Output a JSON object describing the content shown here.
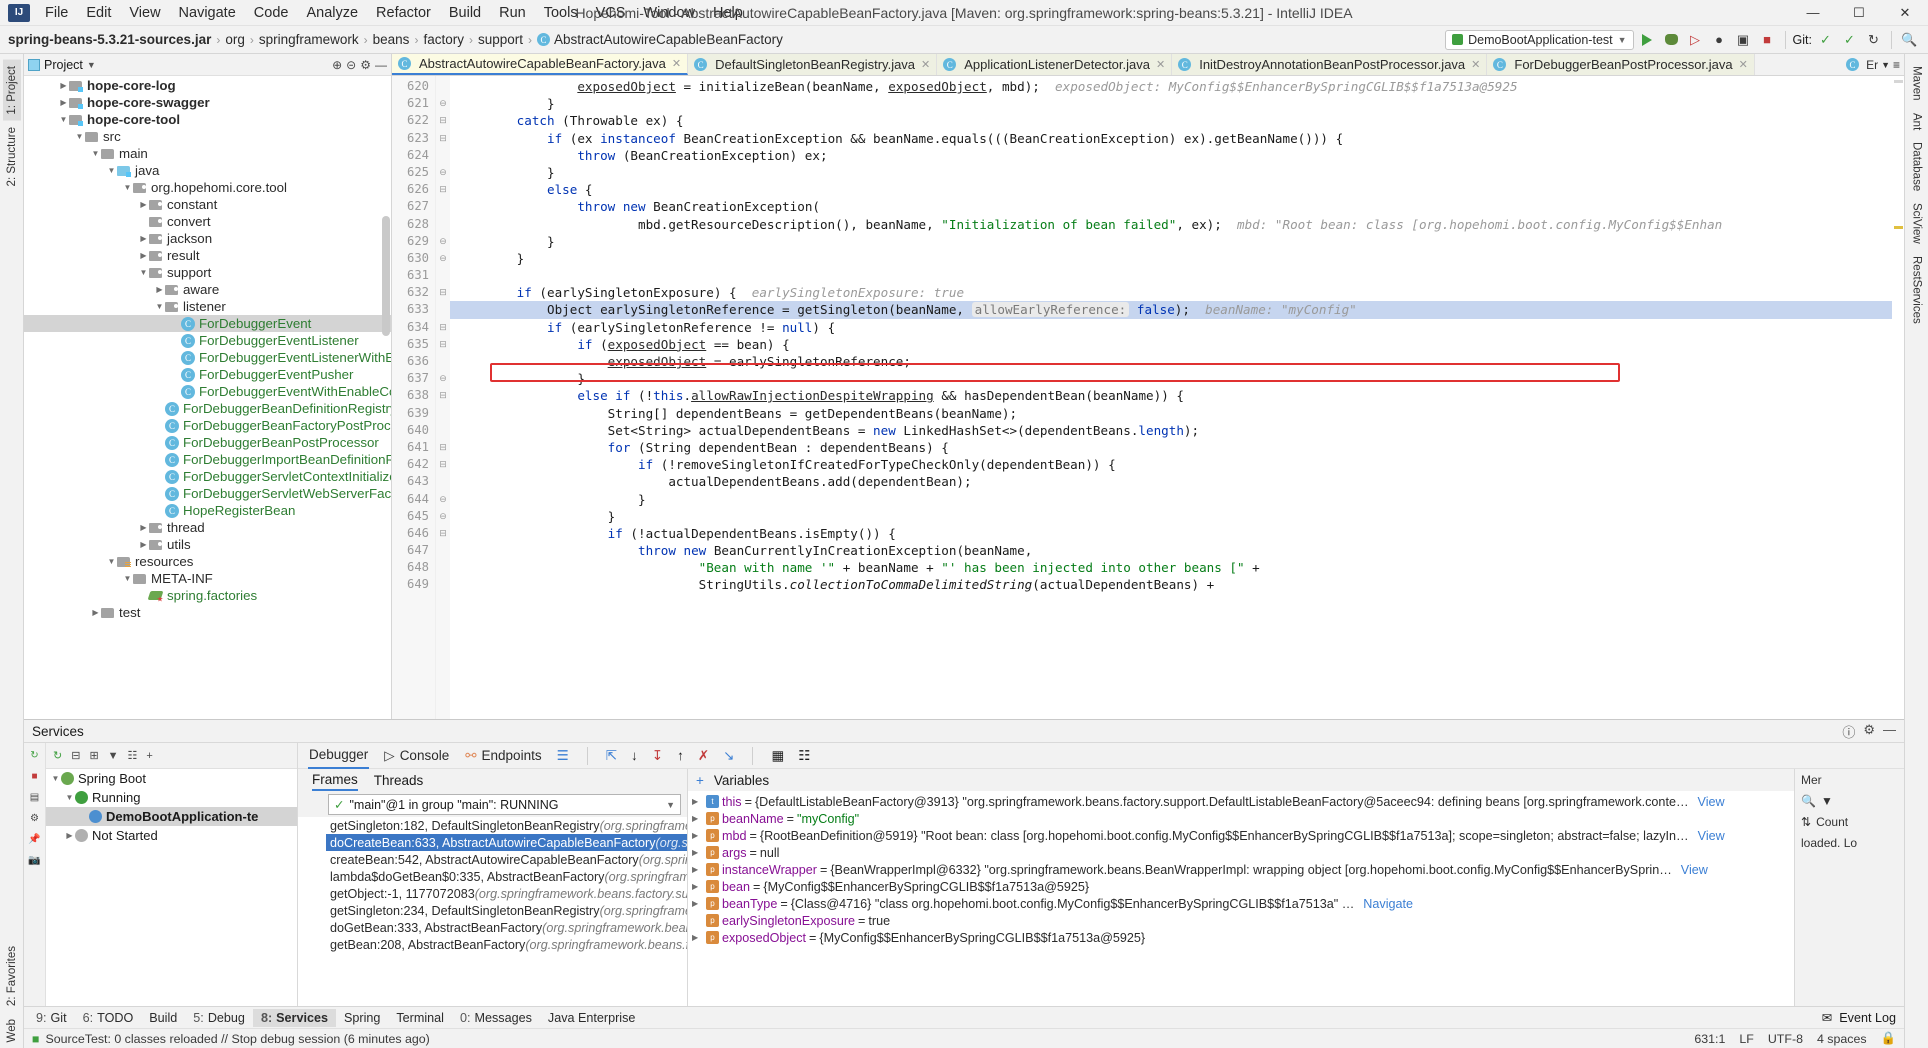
{
  "window": {
    "title": "Hopehomi-Tool - AbstractAutowireCapableBeanFactory.java [Maven: org.springframework:spring-beans:5.3.21] - IntelliJ IDEA",
    "minimize": "—",
    "maximize": "☐",
    "close": "✕"
  },
  "menu": [
    "File",
    "Edit",
    "View",
    "Navigate",
    "Code",
    "Analyze",
    "Refactor",
    "Build",
    "Run",
    "Tools",
    "VCS",
    "Window",
    "Help"
  ],
  "navbar": {
    "crumbs": [
      "spring-beans-5.3.21-sources.jar",
      "org",
      "springframework",
      "beans",
      "factory",
      "support",
      "AbstractAutowireCapableBeanFactory"
    ],
    "run_config": "DemoBootApplication-test",
    "git_label": "Git:"
  },
  "project_panel": {
    "title": "Project",
    "tree": [
      {
        "depth": 2,
        "arrow": "▶",
        "icon": "module",
        "label": "hope-core-log",
        "bold": true,
        "clipped": true
      },
      {
        "depth": 2,
        "arrow": "▶",
        "icon": "module",
        "label": "hope-core-swagger",
        "bold": true
      },
      {
        "depth": 2,
        "arrow": "▼",
        "icon": "module",
        "label": "hope-core-tool",
        "bold": true
      },
      {
        "depth": 3,
        "arrow": "▼",
        "icon": "folder",
        "label": "src"
      },
      {
        "depth": 4,
        "arrow": "▼",
        "icon": "folder",
        "label": "main"
      },
      {
        "depth": 5,
        "arrow": "▼",
        "icon": "source",
        "label": "java"
      },
      {
        "depth": 6,
        "arrow": "▼",
        "icon": "package",
        "label": "org.hopehomi.core.tool"
      },
      {
        "depth": 7,
        "arrow": "▶",
        "icon": "package",
        "label": "constant"
      },
      {
        "depth": 7,
        "arrow": "",
        "icon": "package",
        "label": "convert"
      },
      {
        "depth": 7,
        "arrow": "▶",
        "icon": "package",
        "label": "jackson"
      },
      {
        "depth": 7,
        "arrow": "▶",
        "icon": "package",
        "label": "result"
      },
      {
        "depth": 7,
        "arrow": "▼",
        "icon": "package",
        "label": "support"
      },
      {
        "depth": 8,
        "arrow": "▶",
        "icon": "package",
        "label": "aware"
      },
      {
        "depth": 8,
        "arrow": "▼",
        "icon": "package",
        "label": "listener"
      },
      {
        "depth": 9,
        "arrow": "",
        "icon": "class",
        "label": "ForDebuggerEvent",
        "selected": true
      },
      {
        "depth": 9,
        "arrow": "",
        "icon": "class",
        "label": "ForDebuggerEventListener"
      },
      {
        "depth": 9,
        "arrow": "",
        "icon": "class",
        "label": "ForDebuggerEventListenerWithEnableConfigur"
      },
      {
        "depth": 9,
        "arrow": "",
        "icon": "class",
        "label": "ForDebuggerEventPusher"
      },
      {
        "depth": 9,
        "arrow": "",
        "icon": "class",
        "label": "ForDebuggerEventWithEnableConfiguration"
      },
      {
        "depth": 8,
        "arrow": "",
        "icon": "class",
        "label": "ForDebuggerBeanDefinitionRegistryPostProcesso"
      },
      {
        "depth": 8,
        "arrow": "",
        "icon": "class",
        "label": "ForDebuggerBeanFactoryPostProcessor"
      },
      {
        "depth": 8,
        "arrow": "",
        "icon": "class",
        "label": "ForDebuggerBeanPostProcessor"
      },
      {
        "depth": 8,
        "arrow": "",
        "icon": "class",
        "label": "ForDebuggerImportBeanDefinitionRegistrar"
      },
      {
        "depth": 8,
        "arrow": "",
        "icon": "class",
        "label": "ForDebuggerServletContextInitializer"
      },
      {
        "depth": 8,
        "arrow": "",
        "icon": "class",
        "label": "ForDebuggerServletWebServerFactory"
      },
      {
        "depth": 8,
        "arrow": "",
        "icon": "class",
        "label": "HopeRegisterBean"
      },
      {
        "depth": 7,
        "arrow": "▶",
        "icon": "package",
        "label": "thread"
      },
      {
        "depth": 7,
        "arrow": "▶",
        "icon": "package",
        "label": "utils"
      },
      {
        "depth": 5,
        "arrow": "▼",
        "icon": "resource",
        "label": "resources"
      },
      {
        "depth": 6,
        "arrow": "▼",
        "icon": "folder",
        "label": "META-INF"
      },
      {
        "depth": 7,
        "arrow": "",
        "icon": "factories",
        "label": "spring.factories"
      },
      {
        "depth": 4,
        "arrow": "▶",
        "icon": "folder",
        "label": "test"
      }
    ]
  },
  "editor": {
    "tabs": [
      {
        "label": "AbstractAutowireCapableBeanFactory.java",
        "active": true
      },
      {
        "label": "DefaultSingletonBeanRegistry.java",
        "active": false
      },
      {
        "label": "ApplicationListenerDetector.java",
        "active": false
      },
      {
        "label": "InitDestroyAnnotationBeanPostProcessor.java",
        "active": false
      },
      {
        "label": "ForDebuggerBeanPostProcessor.java",
        "active": false
      }
    ],
    "tab_overflow": "Er",
    "first_line": 620,
    "highlight_line": 633,
    "lines": [
      {
        "n": 620,
        "indent": 16,
        "html": "<span class=\"fieldu\">exposedObject</span> = initializeBean(beanName, <span class=\"fieldu\">exposedObject</span>, mbd);  <span class=\"hint\">exposedObject: MyConfig$$EnhancerBySpringCGLIB$$f1a7513a@5925</span>",
        "fold": ""
      },
      {
        "n": 621,
        "indent": 12,
        "html": "}",
        "fold": "⊖"
      },
      {
        "n": 622,
        "indent": 8,
        "html": "<span class=\"kw\">catch</span> (Throwable ex) {",
        "fold": "⊟"
      },
      {
        "n": 623,
        "indent": 12,
        "html": "<span class=\"kw\">if</span> (ex <span class=\"kw\">instanceof</span> BeanCreationException &amp;&amp; beanName.equals(((BeanCreationException) ex).getBeanName())) {",
        "fold": "⊟"
      },
      {
        "n": 624,
        "indent": 16,
        "html": "<span class=\"kw\">throw</span> (BeanCreationException) ex;",
        "fold": ""
      },
      {
        "n": 625,
        "indent": 12,
        "html": "}",
        "fold": "⊖"
      },
      {
        "n": 626,
        "indent": 12,
        "html": "<span class=\"kw\">else</span> {",
        "fold": "⊟"
      },
      {
        "n": 627,
        "indent": 16,
        "html": "<span class=\"kw\">throw</span> <span class=\"kw\">new</span> BeanCreationException(",
        "fold": ""
      },
      {
        "n": 628,
        "indent": 24,
        "html": "mbd.getResourceDescription(), beanName, <span class=\"str\">\"Initialization of bean failed\"</span>, ex);  <span class=\"hint\">mbd: \"Root bean: class [org.hopehomi.boot.config.MyConfig$$Enhan</span>",
        "fold": ""
      },
      {
        "n": 629,
        "indent": 12,
        "html": "}",
        "fold": "⊖"
      },
      {
        "n": 630,
        "indent": 8,
        "html": "}",
        "fold": "⊖"
      },
      {
        "n": 631,
        "indent": 0,
        "html": "",
        "fold": ""
      },
      {
        "n": 632,
        "indent": 8,
        "html": "<span class=\"kw\">if</span> (earlySingletonExposure) {  <span class=\"hint\">earlySingletonExposure: true</span>",
        "fold": "⊟"
      },
      {
        "n": 633,
        "indent": 12,
        "html": "Object earlySingletonReference = getSingleton(beanName, <span class=\"hintbox\">allowEarlyReference:</span> <span class=\"kw\">false</span>);  <span class=\"hint\">beanName: \"myConfig\"</span>",
        "fold": "",
        "highlight": true
      },
      {
        "n": 634,
        "indent": 12,
        "html": "<span class=\"kw\">if</span> (earlySingletonReference != <span class=\"kw\">null</span>) {",
        "fold": "⊟"
      },
      {
        "n": 635,
        "indent": 16,
        "html": "<span class=\"kw\">if</span> (<span class=\"fieldu\">exposedObject</span> == bean) {",
        "fold": "⊟"
      },
      {
        "n": 636,
        "indent": 20,
        "html": "<span class=\"fieldu\">exposedObject</span> = earlySingletonReference;",
        "fold": ""
      },
      {
        "n": 637,
        "indent": 16,
        "html": "}",
        "fold": "⊖"
      },
      {
        "n": 638,
        "indent": 16,
        "html": "<span class=\"kw\">else if</span> (!<span class=\"kw\">this</span>.<span class=\"fieldu\">allowRawInjectionDespiteWrapping</span> &amp;&amp; hasDependentBean(beanName)) {",
        "fold": "⊟"
      },
      {
        "n": 639,
        "indent": 20,
        "html": "String[] dependentBeans = getDependentBeans(beanName);",
        "fold": ""
      },
      {
        "n": 640,
        "indent": 20,
        "html": "Set&lt;String&gt; actualDependentBeans = <span class=\"kw\">new</span> LinkedHashSet&lt;&gt;(dependentBeans.<span class=\"kw\">length</span>);",
        "fold": ""
      },
      {
        "n": 641,
        "indent": 20,
        "html": "<span class=\"kw\">for</span> (String dependentBean : dependentBeans) {",
        "fold": "⊟"
      },
      {
        "n": 642,
        "indent": 24,
        "html": "<span class=\"kw\">if</span> (!removeSingletonIfCreatedForTypeCheckOnly(dependentBean)) {",
        "fold": "⊟"
      },
      {
        "n": 643,
        "indent": 28,
        "html": "actualDependentBeans.add(dependentBean);",
        "fold": ""
      },
      {
        "n": 644,
        "indent": 24,
        "html": "}",
        "fold": "⊖"
      },
      {
        "n": 645,
        "indent": 20,
        "html": "}",
        "fold": "⊖"
      },
      {
        "n": 646,
        "indent": 20,
        "html": "<span class=\"kw\">if</span> (!actualDependentBeans.isEmpty()) {",
        "fold": "⊟"
      },
      {
        "n": 647,
        "indent": 24,
        "html": "<span class=\"kw\">throw</span> <span class=\"kw\">new</span> BeanCurrentlyInCreationException(beanName,",
        "fold": ""
      },
      {
        "n": 648,
        "indent": 32,
        "html": "<span class=\"str\">\"Bean with name '\"</span> + beanName + <span class=\"str\">\"' has been injected into other beans [\"</span> +",
        "fold": ""
      },
      {
        "n": 649,
        "indent": 32,
        "html": "StringUtils.<span style=\"font-style:italic\">collectionToCommaDelimitedString</span>(actualDependentBeans) +",
        "fold": ""
      }
    ]
  },
  "services": {
    "title": "Services",
    "tree": [
      {
        "depth": 0,
        "arrow": "▼",
        "icon": "spring",
        "label": "Spring Boot"
      },
      {
        "depth": 1,
        "arrow": "▼",
        "icon": "run",
        "label": "Running"
      },
      {
        "depth": 2,
        "arrow": "",
        "icon": "app",
        "label": "DemoBootApplication-te",
        "selected": true
      },
      {
        "depth": 1,
        "arrow": "▶",
        "icon": "stop",
        "label": "Not Started"
      }
    ],
    "debug_tabs": [
      {
        "label": "Debugger",
        "active": true
      },
      {
        "label": "Console",
        "active": false
      },
      {
        "label": "Endpoints",
        "active": false
      }
    ],
    "sub_tabs": [
      {
        "label": "Frames",
        "active": true
      },
      {
        "label": "Threads",
        "active": false
      }
    ],
    "thread_selector": "\"main\"@1 in group \"main\": RUNNING",
    "frames": [
      {
        "method": "getSingleton:182, DefaultSingletonBeanRegistry",
        "pkg": "(org.springframework.beans",
        "selected": false
      },
      {
        "method": "doCreateBean:633, AbstractAutowireCapableBeanFactory",
        "pkg": "(org.springframew",
        "selected": true
      },
      {
        "method": "createBean:542, AbstractAutowireCapableBeanFactory",
        "pkg": "(org.springframework.beans",
        "selected": false
      },
      {
        "method": "lambda$doGetBean$0:335, AbstractBeanFactory",
        "pkg": "(org.springframework.beans.",
        "selected": false
      },
      {
        "method": "getObject:-1, 1177072083",
        "pkg": "(org.springframework.beans.factory.support.Abstr",
        "selected": false
      },
      {
        "method": "getSingleton:234, DefaultSingletonBeanRegistry",
        "pkg": "(org.springframework.beans",
        "selected": false
      },
      {
        "method": "doGetBean:333, AbstractBeanFactory",
        "pkg": "(org.springframework.beans.factory.su",
        "selected": false
      },
      {
        "method": "getBean:208, AbstractBeanFactory",
        "pkg": "(org.springframework.beans.factory.supp",
        "selected": false
      }
    ],
    "variables_title": "Variables",
    "variables": [
      {
        "arrow": "▶",
        "icon": "b",
        "name": "this",
        "eq": " = ",
        "value": "{DefaultListableBeanFactory@3913} \"org.springframework.beans.factory.support.DefaultListableBeanFactory@5aceec94: defining beans [org.springframework.conte…",
        "link": "View"
      },
      {
        "arrow": "▶",
        "icon": "p",
        "name": "beanName",
        "eq": " = ",
        "value": "\"myConfig\"",
        "str": true
      },
      {
        "arrow": "▶",
        "icon": "p",
        "name": "mbd",
        "eq": " = ",
        "value": "{RootBeanDefinition@5919} \"Root bean: class [org.hopehomi.boot.config.MyConfig$$EnhancerBySpringCGLIB$$f1a7513a]; scope=singleton; abstract=false; lazyIn…",
        "link": "View"
      },
      {
        "arrow": "▶",
        "icon": "p",
        "name": "args",
        "eq": " = ",
        "value": "null"
      },
      {
        "arrow": "▶",
        "icon": "p",
        "name": "instanceWrapper",
        "eq": " = ",
        "value": "{BeanWrapperImpl@6332} \"org.springframework.beans.BeanWrapperImpl: wrapping object [org.hopehomi.boot.config.MyConfig$$EnhancerBySprin…",
        "link": "View"
      },
      {
        "arrow": "▶",
        "icon": "p",
        "name": "bean",
        "eq": " = ",
        "value": "{MyConfig$$EnhancerBySpringCGLIB$$f1a7513a@5925}"
      },
      {
        "arrow": "▶",
        "icon": "p",
        "name": "beanType",
        "eq": " = ",
        "value": "{Class@4716} \"class org.hopehomi.boot.config.MyConfig$$EnhancerBySpringCGLIB$$f1a7513a\" …",
        "link": "Navigate"
      },
      {
        "arrow": "",
        "icon": "p",
        "name": "earlySingletonExposure",
        "eq": " = ",
        "value": "true"
      },
      {
        "arrow": "▶",
        "icon": "p",
        "name": "exposedObject",
        "eq": " = ",
        "value": "{MyConfig$$EnhancerBySpringCGLIB$$f1a7513a@5925}"
      }
    ],
    "right_panel": {
      "memory_label": "Mer",
      "count_label": "Count",
      "loaded_label": "loaded. Lo"
    }
  },
  "toolwindow_bar": {
    "left": [
      {
        "num": "9:",
        "label": "Git",
        "selected": false
      },
      {
        "num": "6:",
        "label": "TODO",
        "selected": false
      },
      {
        "num": "",
        "label": "Build",
        "selected": false
      },
      {
        "num": "5:",
        "label": "Debug",
        "selected": false
      },
      {
        "num": "8:",
        "label": "Services",
        "selected": true
      },
      {
        "num": "",
        "label": "Spring",
        "selected": false
      },
      {
        "num": "",
        "label": "Terminal",
        "selected": false
      },
      {
        "num": "0:",
        "label": "Messages",
        "selected": false
      },
      {
        "num": "",
        "label": "Java Enterprise",
        "selected": false
      }
    ],
    "right": [
      "Event Log"
    ]
  },
  "left_strip": [
    "1: Project",
    "2: Structure",
    "2: Favorites",
    "Web"
  ],
  "right_strip": [
    "Maven",
    "Ant",
    "Database",
    "SciView",
    "RestServices"
  ],
  "statusbar": {
    "message": "SourceTest: 0 classes reloaded // Stop debug session (6 minutes ago)",
    "caret": "631:1",
    "line_sep": "LF",
    "encoding": "UTF-8",
    "indent": "4 spaces",
    "branch": "🔒"
  }
}
